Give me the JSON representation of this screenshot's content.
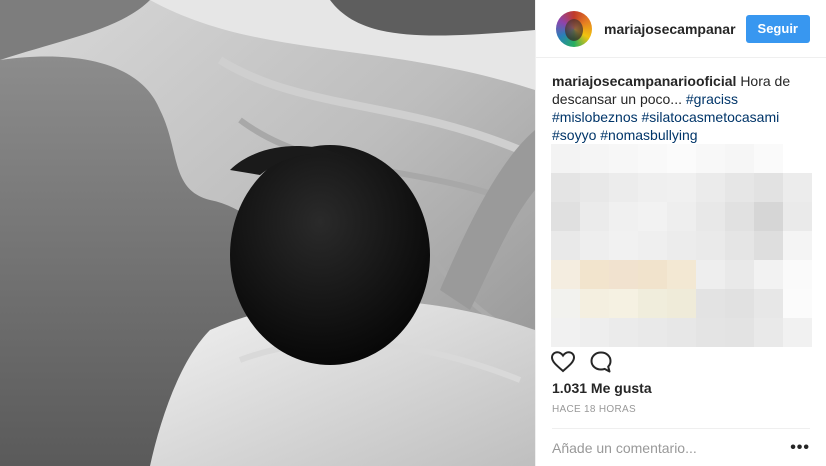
{
  "header": {
    "username": "mariajosecampanariooficial",
    "follow_label": "Seguir",
    "follow_color": "#3897f0"
  },
  "caption": {
    "username": "mariajosecampanariooficial",
    "text": "Hora de descansar un poco...",
    "hashtags": [
      "#graciss",
      "#mislobeznos",
      "#silatocasmetocasami",
      "#soyyo",
      "#nomasbullying"
    ]
  },
  "actions": {
    "like_icon": "heart-icon",
    "comment_icon": "comment-bubble-icon"
  },
  "likes_label": "1.031 Me gusta",
  "timestamp": "HACE 18 HORAS",
  "comment_box": {
    "placeholder": "Añade un comentario...",
    "more_icon": "more-options-icon"
  },
  "colors": {
    "hashtag": "#003569",
    "muted": "#999999",
    "text": "#262626"
  }
}
